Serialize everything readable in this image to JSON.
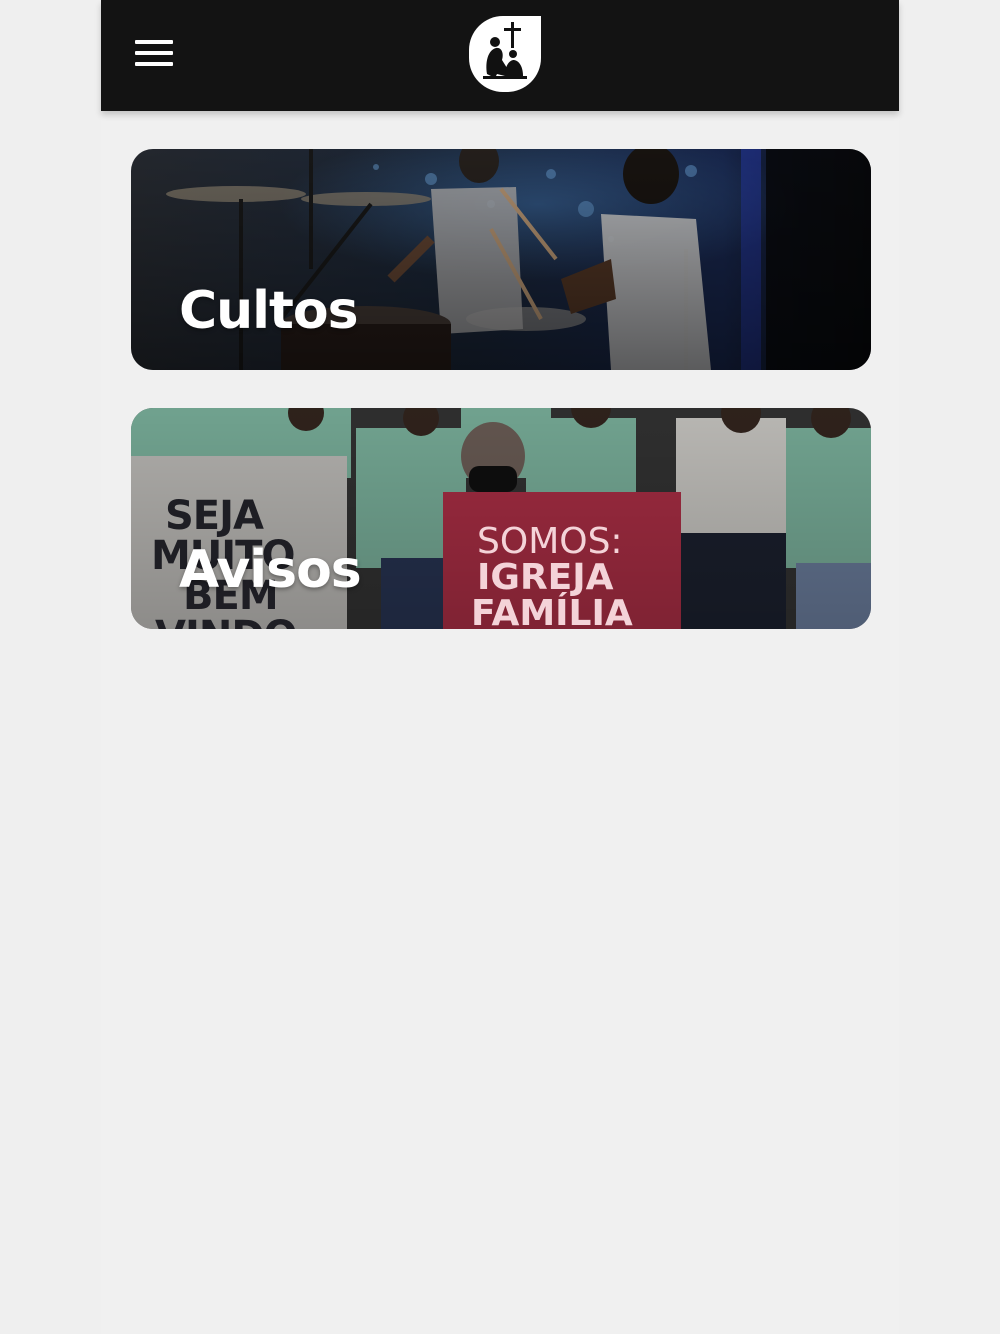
{
  "header": {
    "menu_icon": "hamburger-menu-icon",
    "logo_icon": "church-logo-icon",
    "background": "#131313"
  },
  "cards": [
    {
      "title": "Cultos"
    },
    {
      "title": "Avisos",
      "sign_left": [
        "SEJA",
        "MUITO",
        "BEM",
        "VINDO"
      ],
      "sign_right": [
        "SOMOS:",
        "IGREJA",
        "FAMÍLIA"
      ]
    }
  ],
  "colors": {
    "page_background": "#f0f0f0",
    "card_title": "#ffffff",
    "sign_pink": "#c4354f",
    "shirt_green": "#8ccab2"
  }
}
